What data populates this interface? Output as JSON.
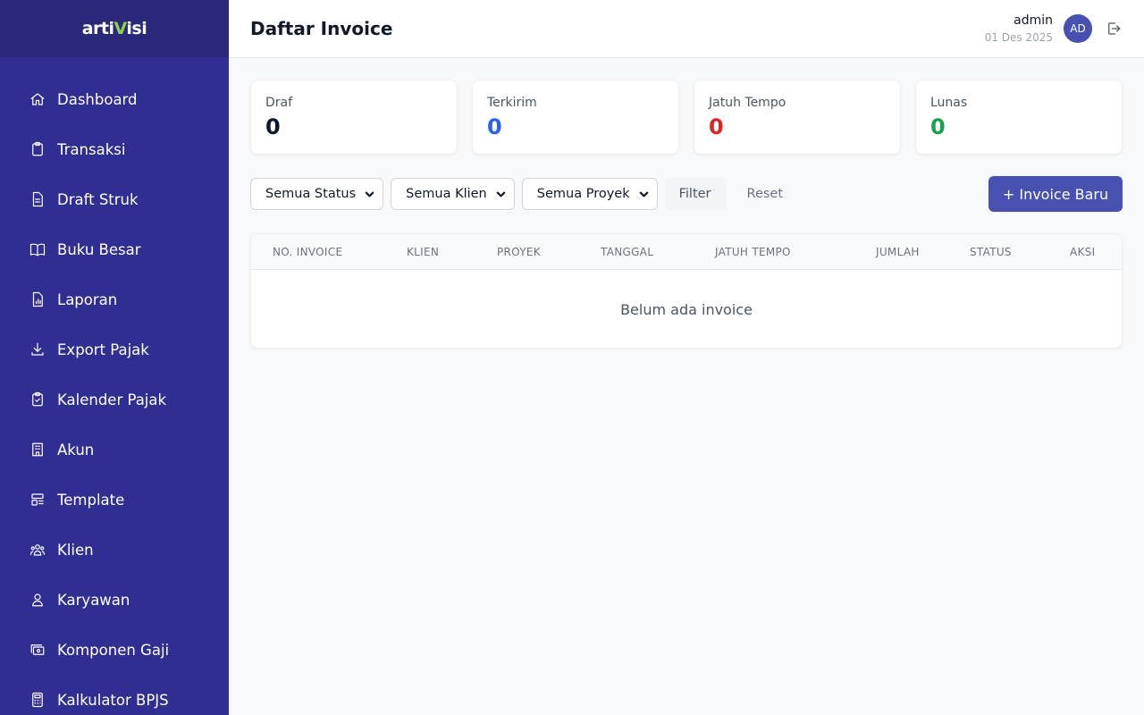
{
  "brand": {
    "logo_main": "arti",
    "logo_accent": "V",
    "logo_tail": "isi"
  },
  "sidebar": {
    "items": [
      {
        "label": "Dashboard",
        "icon": "home-icon"
      },
      {
        "label": "Transaksi",
        "icon": "clipboard-icon"
      },
      {
        "label": "Draft Struk",
        "icon": "document-icon"
      },
      {
        "label": "Buku Besar",
        "icon": "book-icon"
      },
      {
        "label": "Laporan",
        "icon": "report-icon"
      },
      {
        "label": "Export Pajak",
        "icon": "download-icon"
      },
      {
        "label": "Kalender Pajak",
        "icon": "clipboard-check-icon"
      },
      {
        "label": "Akun",
        "icon": "building-icon"
      },
      {
        "label": "Template",
        "icon": "template-icon"
      },
      {
        "label": "Klien",
        "icon": "users-icon"
      },
      {
        "label": "Karyawan",
        "icon": "user-icon"
      },
      {
        "label": "Komponen Gaji",
        "icon": "cash-icon"
      },
      {
        "label": "Kalkulator BPJS",
        "icon": "calculator-icon"
      }
    ]
  },
  "header": {
    "title": "Daftar Invoice",
    "user_name": "admin",
    "date": "01 Des 2025",
    "avatar_initials": "AD"
  },
  "stats": [
    {
      "label": "Draf",
      "value": "0",
      "color": "#111827"
    },
    {
      "label": "Terkirim",
      "value": "0",
      "color": "#2563eb"
    },
    {
      "label": "Jatuh Tempo",
      "value": "0",
      "color": "#dc2626"
    },
    {
      "label": "Lunas",
      "value": "0",
      "color": "#16a34a"
    }
  ],
  "filters": {
    "status": "Semua Status",
    "client": "Semua Klien",
    "project": "Semua Proyek",
    "filter_label": "Filter",
    "reset_label": "Reset",
    "new_invoice_label": "+ Invoice Baru"
  },
  "table": {
    "columns": [
      "NO. INVOICE",
      "KLIEN",
      "PROYEK",
      "TANGGAL",
      "JATUH TEMPO",
      "JUMLAH",
      "STATUS",
      "AKSI"
    ],
    "empty_message": "Belum ada invoice"
  },
  "colors": {
    "sidebar_bg": "#312e91",
    "primary": "#4651b0"
  }
}
